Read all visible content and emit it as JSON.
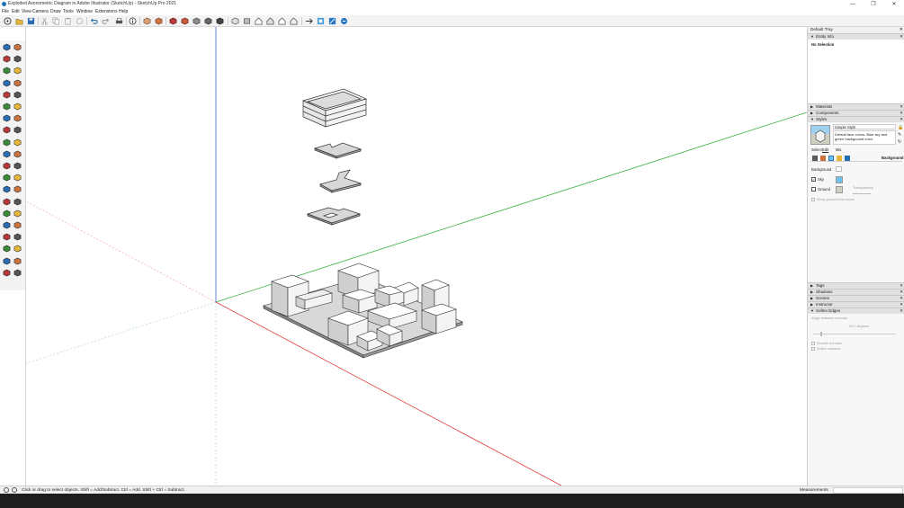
{
  "window": {
    "title": "Exploded Axonometric Diagram in Adobe Illustrator (SketchUp) - SketchUp Pro 2021",
    "controls": [
      "—",
      "❐",
      "✕"
    ]
  },
  "menu": [
    "File",
    "Edit",
    "View",
    "Camera",
    "Draw",
    "Tools",
    "Window",
    "Extensions",
    "Help"
  ],
  "toolbar": {
    "icons": [
      "new-icon",
      "open-icon",
      "save-icon",
      "cut-icon",
      "copy-icon",
      "paste-icon",
      "erase-icon",
      "undo-icon",
      "redo-icon",
      "print-icon",
      "model-info-icon",
      "xray-icon",
      "back-edges-icon",
      "wireframe-icon",
      "hidden-line-icon",
      "shaded-icon",
      "textured-icon",
      "monochrome-icon",
      "iso-view-icon",
      "top-view-icon",
      "front-view-icon",
      "right-view-icon",
      "back-view-icon",
      "left-view-icon",
      "section-plane-icon",
      "display-section-icon",
      "section-cuts-icon"
    ]
  },
  "left_tools": [
    "select-icon",
    "component-icon",
    "paint-bucket-icon",
    "eraser-icon",
    "line-icon",
    "freehand-icon",
    "rectangle-icon",
    "rotated-rectangle-icon",
    "circle-icon",
    "polygon-icon",
    "arc-icon",
    "pie-icon",
    "two-point-arc-icon",
    "three-point-arc-icon",
    "move-icon",
    "push-pull-icon",
    "rotate-icon",
    "follow-me-icon",
    "scale-icon",
    "offset-icon",
    "tape-measure-icon",
    "dimension-icon",
    "protractor-icon",
    "text-icon",
    "axes-icon",
    "3d-text-icon",
    "orbit-icon",
    "pan-icon",
    "zoom-icon",
    "zoom-window-icon",
    "zoom-extents-icon",
    "previous-view-icon",
    "position-camera-icon",
    "walk-icon",
    "look-around-icon",
    "section-plane-icon",
    "sandbox-icon",
    "stamp-icon",
    "drape-icon",
    "flip-edge-icon"
  ],
  "tray": {
    "title": "Default Tray",
    "entity_info": {
      "header": "Entity Info",
      "value": "No Selection"
    },
    "panels_top": [
      "Materials",
      "Components"
    ],
    "styles": {
      "header": "Styles",
      "name": "Simple Style",
      "description": "Default face colors. Blue sky and green background color.",
      "tabs": [
        "Select",
        "Edit",
        "Mix"
      ],
      "active_tab": "Edit",
      "section_label": "Background",
      "background_label": "Background",
      "sky_label": "Sky",
      "ground_label": "Ground",
      "transparency_label": "Transparency",
      "show_ground_label": "Show ground from below",
      "sky_color": "#6ec1ec",
      "ground_color": "#cfcfc2",
      "background_color": "#ffffff"
    },
    "panels_bottom": [
      "Tags",
      "Shadows",
      "Scenes",
      "Instructor"
    ],
    "soften": {
      "header": "Soften Edges",
      "angle_label": "Angle between normals:",
      "angle_value": "20.0 degrees",
      "smooth_label": "Smooth normals",
      "coplanar_label": "Soften coplanar"
    }
  },
  "status": {
    "text": "Click or drag to select objects. Shift = Add/Subtract. Ctrl = Add. Shift + Ctrl = Subtract.",
    "measurements_label": "Measurements"
  },
  "colors": {
    "green_axis": "#3cb043",
    "red_axis": "#e03b3b",
    "blue_axis": "#3a5fd0",
    "accent": "#1f6fb5"
  }
}
